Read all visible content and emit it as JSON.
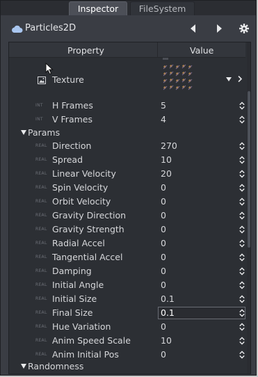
{
  "tabs": [
    {
      "label": "Inspector",
      "active": true
    },
    {
      "label": "FileSystem",
      "active": false
    }
  ],
  "header": {
    "node_icon": "particles-cloud-icon",
    "node_name": "Particles2D",
    "buttons": [
      "prev-arrow-icon",
      "next-arrow-icon",
      "gear-icon"
    ]
  },
  "table": {
    "col_property": "Property",
    "col_value": "Value"
  },
  "texture": {
    "label": "Texture",
    "icon": "image-icon"
  },
  "frames": [
    {
      "type": "INT",
      "name": "H Frames",
      "value": "5"
    },
    {
      "type": "INT",
      "name": "V Frames",
      "value": "4"
    }
  ],
  "sections": {
    "params": "Params",
    "randomness": "Randomness"
  },
  "params": [
    {
      "type": "REAL",
      "name": "Direction",
      "value": "270"
    },
    {
      "type": "REAL",
      "name": "Spread",
      "value": "10"
    },
    {
      "type": "REAL",
      "name": "Linear Velocity",
      "value": "20"
    },
    {
      "type": "REAL",
      "name": "Spin Velocity",
      "value": "0"
    },
    {
      "type": "REAL",
      "name": "Orbit Velocity",
      "value": "0"
    },
    {
      "type": "REAL",
      "name": "Gravity Direction",
      "value": "0"
    },
    {
      "type": "REAL",
      "name": "Gravity Strength",
      "value": "0"
    },
    {
      "type": "REAL",
      "name": "Radial Accel",
      "value": "0"
    },
    {
      "type": "REAL",
      "name": "Tangential Accel",
      "value": "0"
    },
    {
      "type": "REAL",
      "name": "Damping",
      "value": "0"
    },
    {
      "type": "REAL",
      "name": "Initial Angle",
      "value": "0"
    },
    {
      "type": "REAL",
      "name": "Initial Size",
      "value": "0.1"
    },
    {
      "type": "REAL",
      "name": "Final Size",
      "value": "0.1",
      "editing": true
    },
    {
      "type": "REAL",
      "name": "Hue Variation",
      "value": "0"
    },
    {
      "type": "REAL",
      "name": "Anim Speed Scale",
      "value": "10"
    },
    {
      "type": "REAL",
      "name": "Anim Initial Pos",
      "value": "0"
    }
  ],
  "colors": {
    "panel_bg": "#2c2f34",
    "window_bg": "#3a3d44",
    "accent_icon": "#a9c6ef"
  }
}
